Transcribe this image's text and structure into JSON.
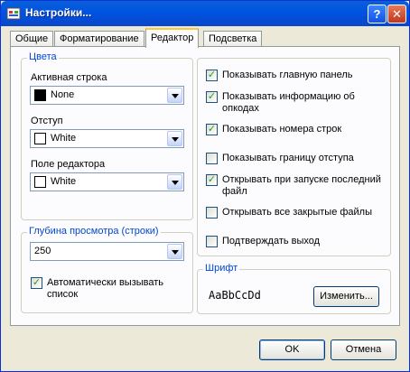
{
  "window": {
    "title": "Настройки..."
  },
  "titlebar": {
    "help_label": "?",
    "close_label": "✕"
  },
  "tabs": [
    "Общие",
    "Форматирование",
    "Редактор",
    "Подсветка"
  ],
  "active_tab": "Редактор",
  "colors": {
    "group_title": "Цвета",
    "active_line": {
      "label": "Активная строка",
      "value": "None",
      "swatch": "#000000"
    },
    "indent": {
      "label": "Отступ",
      "value": "White",
      "swatch": "#ffffff"
    },
    "editor_field": {
      "label": "Поле редактора",
      "value": "White",
      "swatch": "#ffffff"
    }
  },
  "depth": {
    "group_title": "Глубина просмотра (строки)",
    "value": "250",
    "autocall": {
      "label": "Автоматически вызывать список",
      "checked": true
    }
  },
  "options": [
    {
      "label": "Показывать главную панель",
      "checked": true
    },
    {
      "label": "Показывать информацию об опкодах",
      "checked": true
    },
    {
      "label": "Показывать номера строк",
      "checked": true
    },
    {
      "label": "Показывать границу отступа",
      "checked": false
    },
    {
      "label": "Открывать при запуске последний файл",
      "checked": true
    },
    {
      "label": "Открывать все закрытые файлы",
      "checked": false
    },
    {
      "label": "Подтверждать выход",
      "checked": false
    }
  ],
  "font": {
    "group_title": "Шрифт",
    "sample": "AaBbCcDd",
    "change_label": "Изменить..."
  },
  "footer": {
    "ok_label": "OK",
    "cancel_label": "Отмена"
  },
  "check_mark": "✓"
}
